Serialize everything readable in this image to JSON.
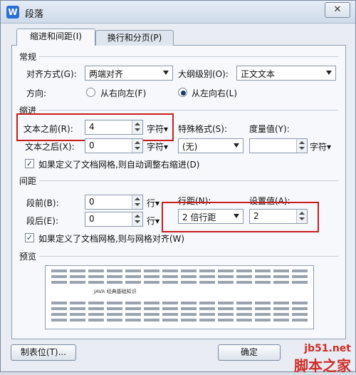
{
  "window": {
    "title": "段落",
    "app_icon": "W",
    "close_glyph": "✕"
  },
  "tabs": [
    {
      "label": "缩进和间距(I)"
    },
    {
      "label": "换行和分页(P)"
    }
  ],
  "general": {
    "section": "常规",
    "alignment_label": "对齐方式(G):",
    "alignment_value": "两端对齐",
    "outline_label": "大纲级别(O):",
    "outline_value": "正文文本",
    "direction_label": "方向:",
    "rtl_label": "从右向左(F)",
    "ltr_label": "从左向右(L)",
    "direction_selected": "ltr"
  },
  "indent": {
    "section": "缩进",
    "before_label": "文本之前(R):",
    "before_value": "4",
    "before_unit": "字符▾",
    "special_label": "特殊格式(S):",
    "measure_label": "度量值(Y):",
    "after_label": "文本之后(X):",
    "after_value": "0",
    "after_unit": "字符▾",
    "special_value": "(无)",
    "measure_value": "",
    "measure_unit": "字符▾",
    "auto_right_label": "如果定义了文档网格,则自动调整右缩进(D)",
    "auto_right_checked": true
  },
  "spacing": {
    "section": "间距",
    "before_label": "段前(B):",
    "before_value": "0",
    "before_unit": "行▾",
    "after_label": "段后(E):",
    "after_value": "0",
    "after_unit": "行▾",
    "line_spacing_label": "行距(N):",
    "line_spacing_value": "2 倍行距",
    "set_value_label": "设置值(A):",
    "set_value": "2",
    "snap_grid_label": "如果定义了文档网格,则与网格对齐(W)",
    "snap_grid_checked": true
  },
  "preview": {
    "section": "预览",
    "sample_text": "JAVA 经典基础知识"
  },
  "buttons": {
    "tabs_label": "制表位(T)...",
    "ok_label": "确定"
  },
  "watermark": {
    "line1": "jb51.net",
    "line2": "脚本之家"
  },
  "icons": {
    "close": "close-icon",
    "app": "wps-writer-icon",
    "dropdown": "chevron-down-icon",
    "spin": "spin-arrows-icon"
  }
}
